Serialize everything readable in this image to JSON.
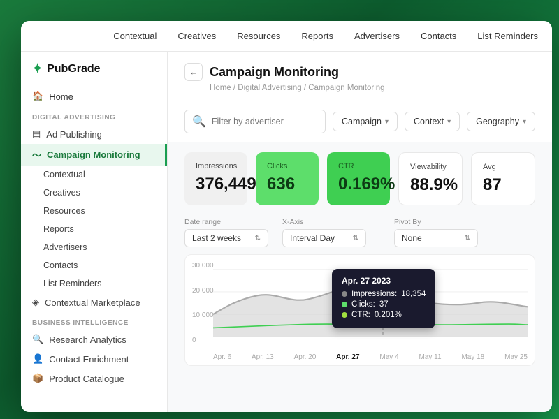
{
  "app": {
    "logo": "✦",
    "title": "PubGrade"
  },
  "topnav": {
    "items": [
      "Contextual",
      "Creatives",
      "Resources",
      "Reports",
      "Advertisers",
      "Contacts",
      "List Reminders"
    ]
  },
  "sidebar": {
    "home_label": "Home",
    "section1_label": "Digital Advertising",
    "items1": [
      {
        "label": "Ad Publishing",
        "icon": "▤",
        "active": false,
        "sub": false
      },
      {
        "label": "Campaign Monitoring",
        "icon": "📈",
        "active": true,
        "sub": false
      },
      {
        "label": "Contextual",
        "icon": "",
        "active": false,
        "sub": true
      },
      {
        "label": "Creatives",
        "icon": "",
        "active": false,
        "sub": true
      },
      {
        "label": "Resources",
        "icon": "",
        "active": false,
        "sub": true
      },
      {
        "label": "Reports",
        "icon": "",
        "active": false,
        "sub": true
      },
      {
        "label": "Advertisers",
        "icon": "",
        "active": false,
        "sub": true
      },
      {
        "label": "Contacts",
        "icon": "",
        "active": false,
        "sub": true
      },
      {
        "label": "List Reminders",
        "icon": "",
        "active": false,
        "sub": true
      }
    ],
    "items1_extra": [
      {
        "label": "Contextual Marketplace",
        "icon": "◈",
        "active": false,
        "sub": false
      }
    ],
    "section2_label": "Business Intelligence",
    "items2": [
      {
        "label": "Research Analytics",
        "icon": "🔍",
        "active": false
      },
      {
        "label": "Contact Enrichment",
        "icon": "👤",
        "active": false
      },
      {
        "label": "Product Catalogue",
        "icon": "📦",
        "active": false
      }
    ]
  },
  "content": {
    "back_label": "←",
    "page_title": "Campaign Monitoring",
    "breadcrumb": "Home / Digital Advertising / Campaign Monitoring",
    "filter_placeholder": "Filter by advertiser",
    "filter_buttons": [
      {
        "label": "Campaign",
        "has_arrow": true
      },
      {
        "label": "Context",
        "has_arrow": true
      },
      {
        "label": "Geography",
        "has_arrow": true
      }
    ],
    "metrics": [
      {
        "id": "impressions",
        "label": "Impressions",
        "value": "376,449"
      },
      {
        "id": "clicks",
        "label": "Clicks",
        "value": "636"
      },
      {
        "id": "ctr",
        "label": "CTR",
        "value": "0.169%"
      },
      {
        "id": "viewability",
        "label": "Viewability",
        "value": "88.9%"
      },
      {
        "id": "avg",
        "label": "Avg",
        "value": "87"
      }
    ],
    "chart": {
      "date_range_label": "Date range",
      "date_range_value": "Last 2 weeks",
      "xaxis_label": "X-Axis",
      "xaxis_value": "Interval Day",
      "pivotby_label": "Pivot By",
      "pivotby_value": "None",
      "y_labels": [
        "30,000",
        "20,000",
        "10,000",
        "0"
      ],
      "x_labels": [
        "Apr. 6",
        "Apr. 13",
        "Apr. 20",
        "Apr. 27",
        "May 4",
        "May 11",
        "May 18",
        "May 25"
      ],
      "tooltip": {
        "date": "Apr. 27 2023",
        "impressions_label": "Impressions:",
        "impressions_value": "18,354",
        "clicks_label": "Clicks:",
        "clicks_value": "37",
        "ctr_label": "CTR:",
        "ctr_value": "0.201%"
      }
    }
  }
}
